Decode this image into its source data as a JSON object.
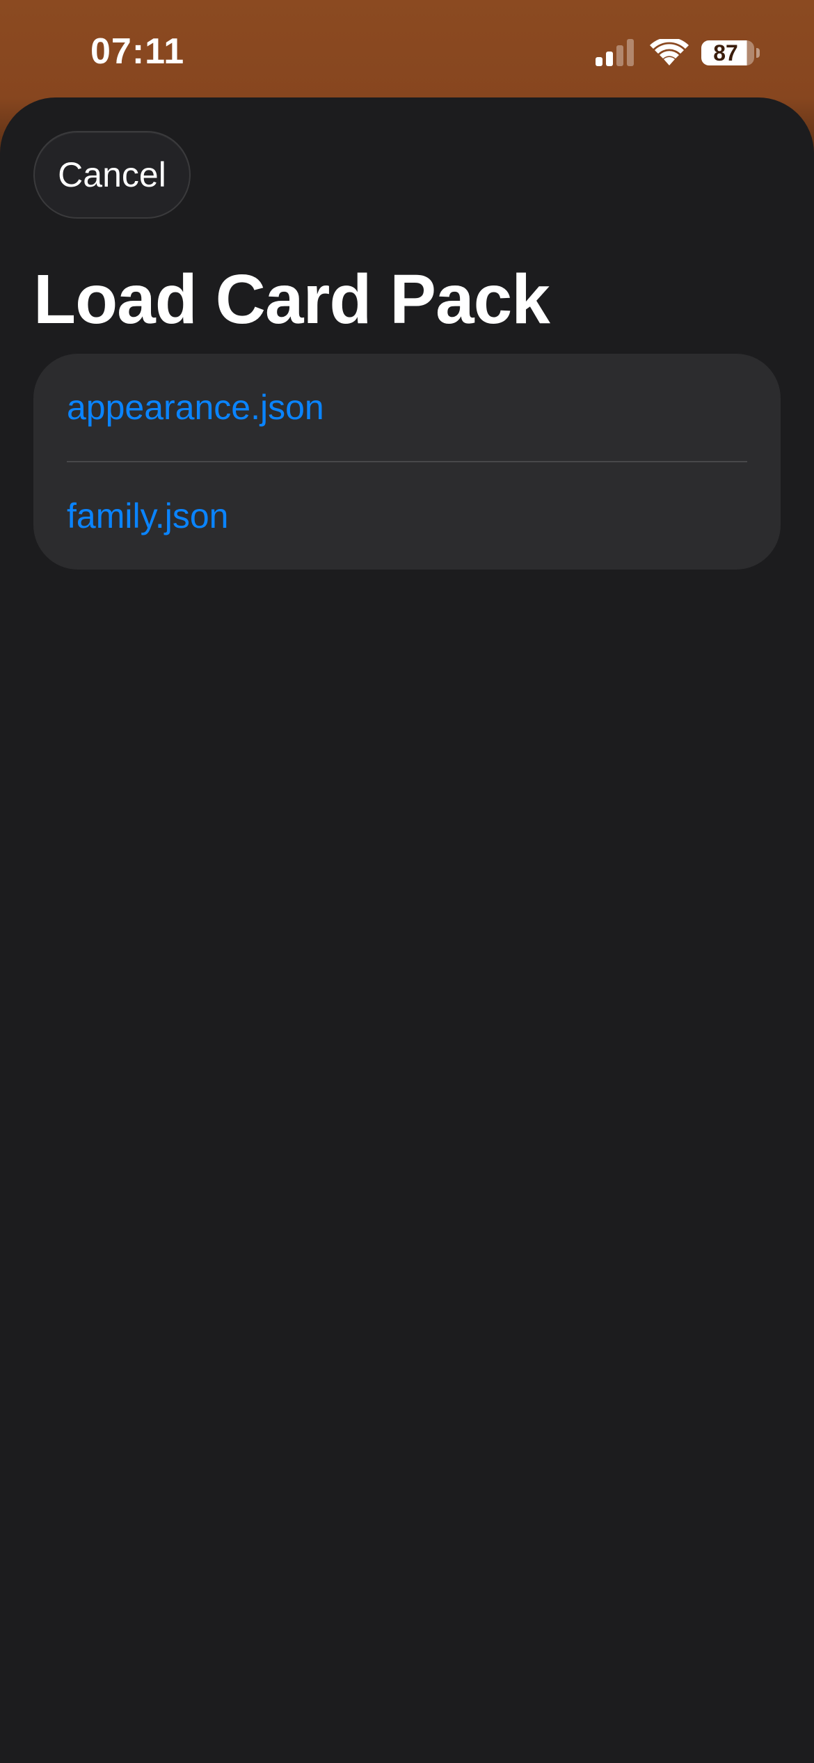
{
  "status_bar": {
    "time": "07:11",
    "battery_percent": "87",
    "battery_level": 0.87,
    "signal_bars_active": 2,
    "signal_bars_total": 4,
    "icons": [
      "signal-icon",
      "wifi-icon",
      "battery-icon"
    ]
  },
  "sheet": {
    "cancel_label": "Cancel",
    "title": "Load Card Pack",
    "files": [
      {
        "name": "appearance.json"
      },
      {
        "name": "family.json"
      }
    ]
  },
  "colors": {
    "accent": "#0a84ff",
    "background": "#1c1c1e",
    "group_background": "#2c2c2e",
    "wallpaper": "#8a4a22"
  }
}
